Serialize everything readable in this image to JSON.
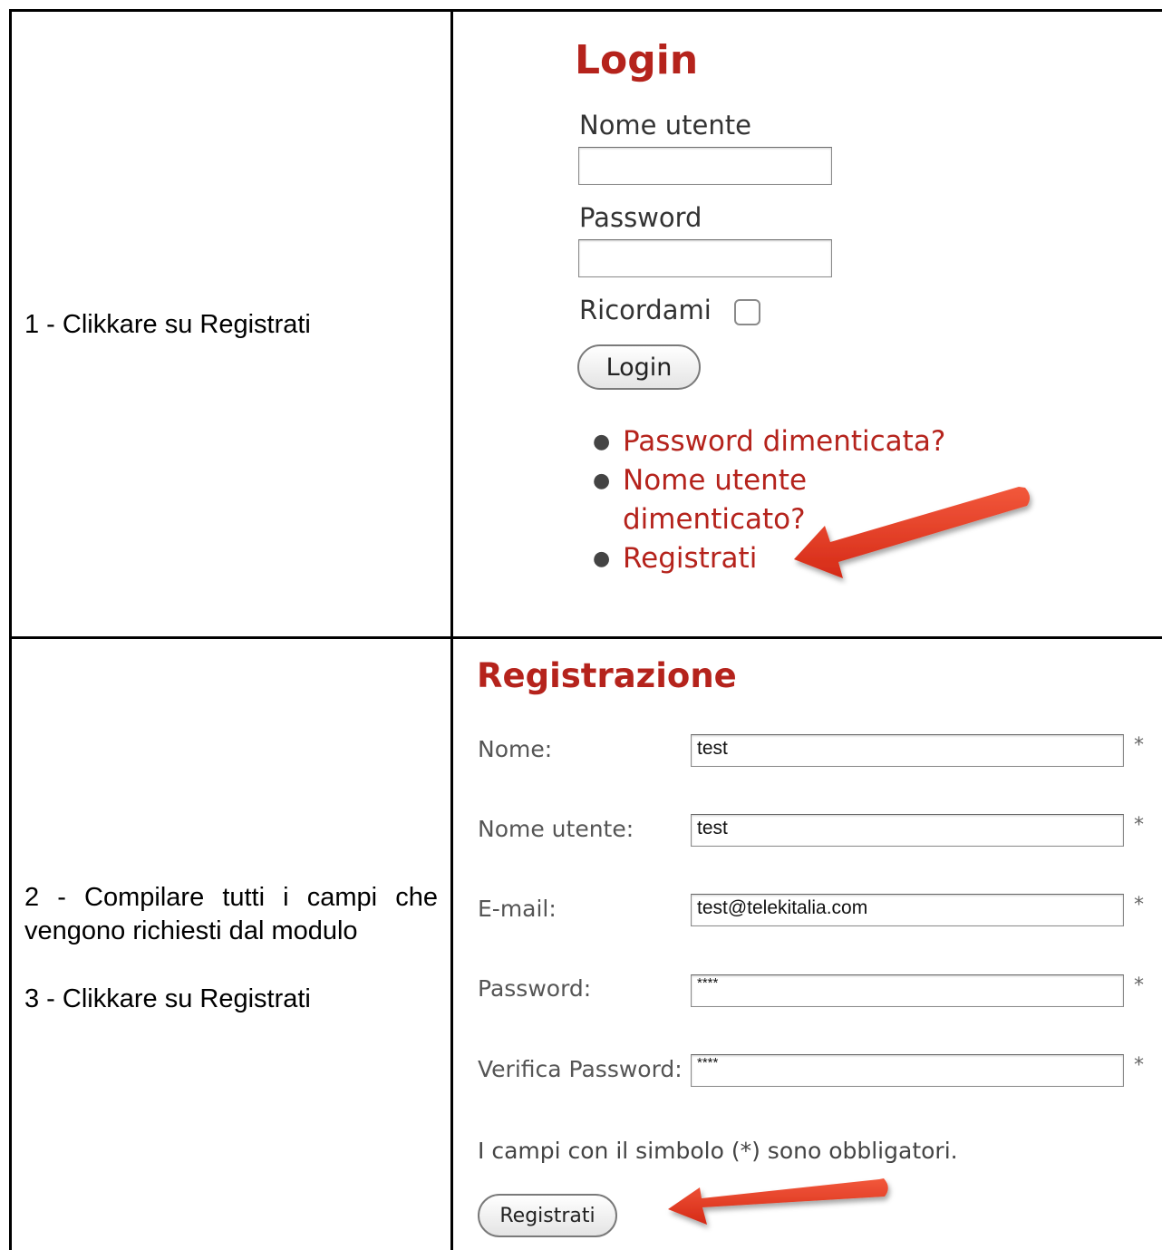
{
  "instructions": {
    "step1": "1 - Clikkare su Registrati",
    "step2": "2 - Compilare tutti i campi che vengono richiesti dal modulo",
    "step3": "3 - Clikkare su Registrati"
  },
  "login": {
    "title": "Login",
    "username_label": "Nome utente",
    "password_label": "Password",
    "remember_label": "Ricordami",
    "remember_checked": false,
    "button_label": "Login",
    "links": [
      "Password dimenticata?",
      "Nome utente dimenticato?",
      "Registrati"
    ]
  },
  "registration": {
    "title": "Registrazione",
    "fields": [
      {
        "label": "Nome:",
        "value": "test"
      },
      {
        "label": "Nome utente:",
        "value": "test"
      },
      {
        "label": "E-mail:",
        "value": "test@telekitalia.com"
      },
      {
        "label": "Password:",
        "value": "****"
      },
      {
        "label": "Verifica Password:",
        "value": "****"
      }
    ],
    "required_marker": "*",
    "required_note": "I campi con il simbolo (*) sono obbligatori.",
    "button_label": "Registrati"
  },
  "colors": {
    "accent_red": "#b5231c",
    "arrow_red": "#e03a22"
  },
  "icons": [
    "checkbox-icon",
    "bullet-icon",
    "red-arrow-icon"
  ]
}
